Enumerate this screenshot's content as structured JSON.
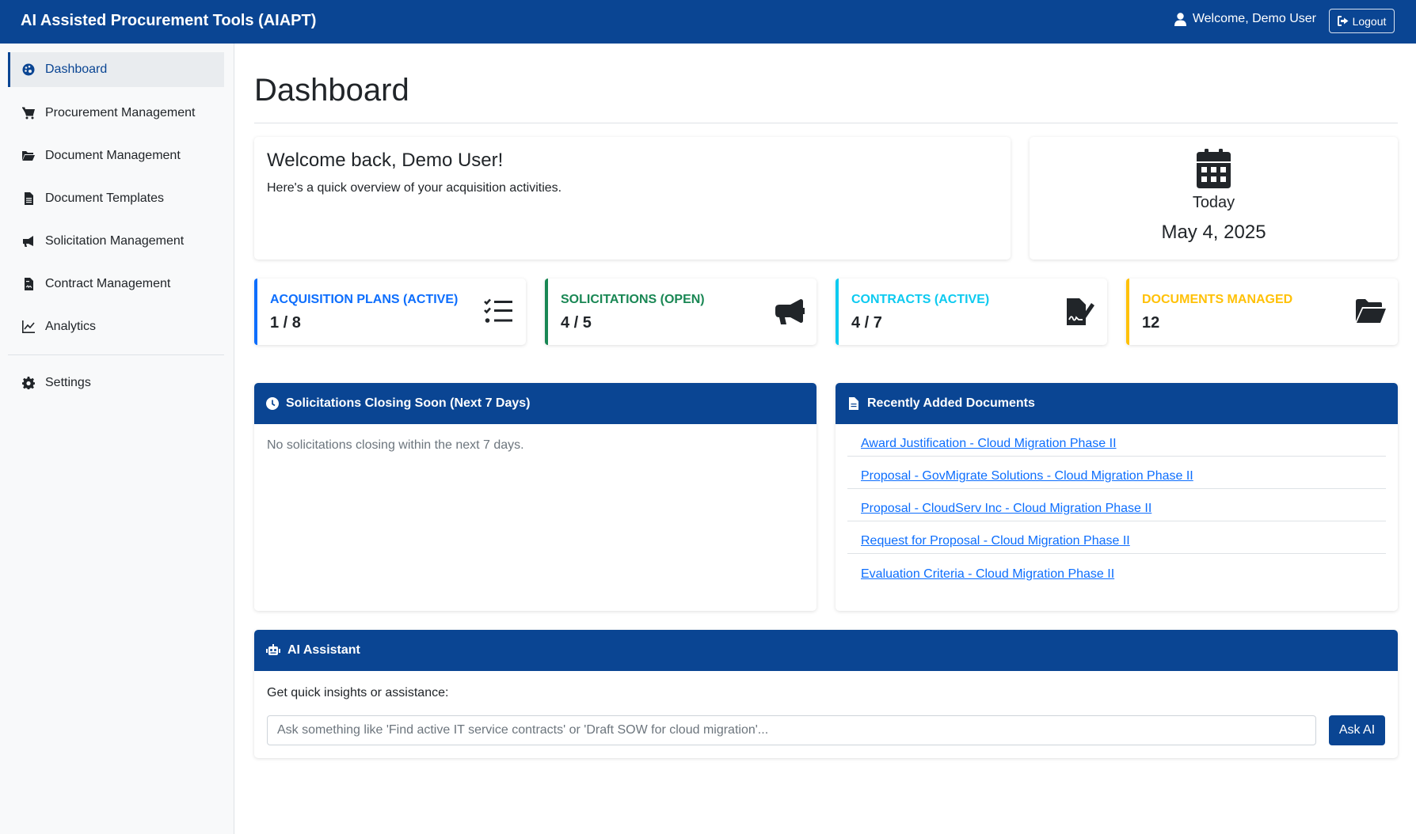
{
  "app": {
    "title": "AI Assisted Procurement Tools (AIAPT)",
    "welcome": "Welcome, Demo User",
    "logout_label": "Logout"
  },
  "sidebar": {
    "items": [
      {
        "label": "Dashboard",
        "icon": "palette-icon",
        "active": true
      },
      {
        "label": "Procurement Management",
        "icon": "cart-icon"
      },
      {
        "label": "Document Management",
        "icon": "folder-open-icon"
      },
      {
        "label": "Document Templates",
        "icon": "file-text-icon"
      },
      {
        "label": "Solicitation Management",
        "icon": "megaphone-icon"
      },
      {
        "label": "Contract Management",
        "icon": "file-contract-icon"
      },
      {
        "label": "Analytics",
        "icon": "line-chart-icon"
      },
      {
        "label": "Settings",
        "icon": "gear-icon"
      }
    ]
  },
  "main": {
    "title": "Dashboard",
    "welcome_card": {
      "heading": "Welcome back, Demo User!",
      "text": "Here's a quick overview of your acquisition activities."
    },
    "date_card": {
      "label": "Today",
      "value": "May 4, 2025",
      "icon": "calendar-icon"
    },
    "stats": [
      {
        "title": "Acquisition Plans (Active)",
        "value": "1 / 8",
        "color": "#0d6efd",
        "icon": "list-check-icon"
      },
      {
        "title": "Solicitations (Open)",
        "value": "4 / 5",
        "color": "#198754",
        "icon": "bullhorn-icon"
      },
      {
        "title": "Contracts (Active)",
        "value": "4 / 7",
        "color": "#0dcaf0",
        "icon": "file-signature-icon"
      },
      {
        "title": "Documents Managed",
        "value": "12",
        "color": "#ffc107",
        "icon": "folder-open-icon"
      }
    ],
    "closing_panel": {
      "title": "Solicitations Closing Soon (Next 7 Days)",
      "empty_text": "No solicitations closing within the next 7 days."
    },
    "recent_panel": {
      "title": "Recently Added Documents",
      "documents": [
        "Award Justification - Cloud Migration Phase II",
        "Proposal - GovMigrate Solutions - Cloud Migration Phase II",
        "Proposal - CloudServ Inc - Cloud Migration Phase II",
        "Request for Proposal - Cloud Migration Phase II",
        "Evaluation Criteria - Cloud Migration Phase II"
      ]
    },
    "ai_panel": {
      "title": "AI Assistant",
      "prompt": "Get quick insights or assistance:",
      "placeholder": "Ask something like 'Find active IT service contracts' or 'Draft SOW for cloud migration'...",
      "button": "Ask AI"
    }
  },
  "colors": {
    "primary": "#0a4593",
    "link": "#0d6efd"
  }
}
